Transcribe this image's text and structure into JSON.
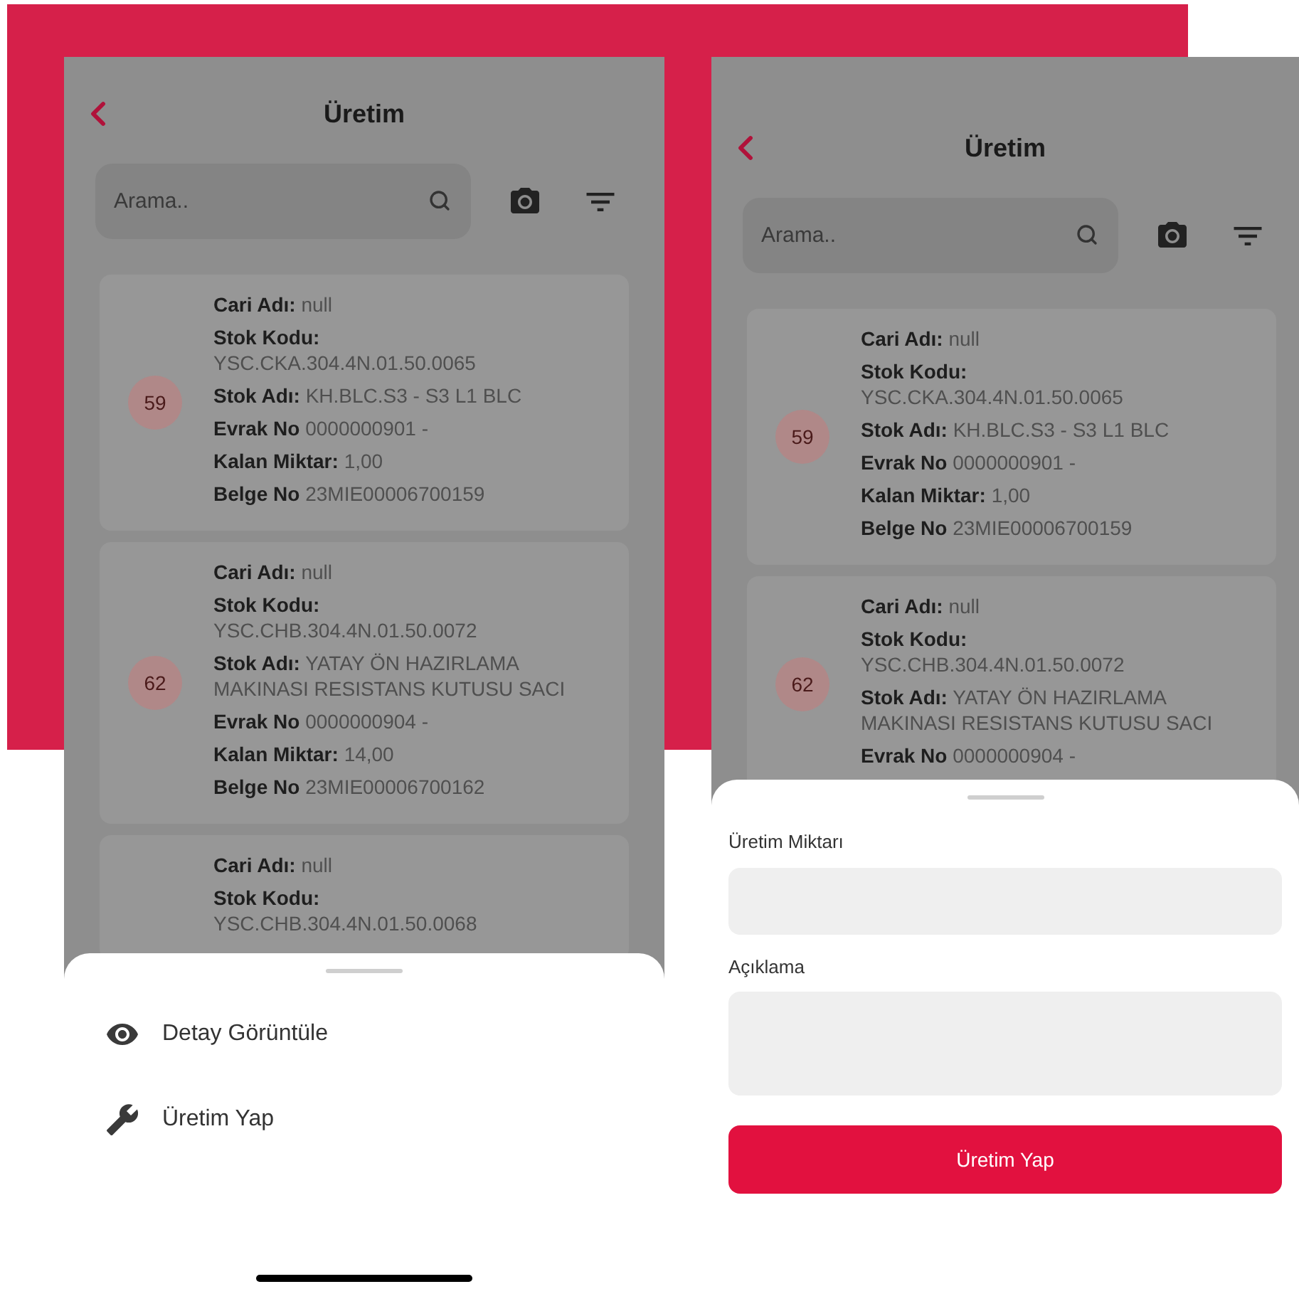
{
  "screens": [
    {
      "title": "Üretim",
      "search": {
        "placeholder": "Arama.."
      },
      "records": [
        {
          "number": "59",
          "fields": [
            {
              "label": "Cari Adı:",
              "value": "null",
              "kind": "inline"
            },
            {
              "label": "Stok Kodu:",
              "value": "YSC.CKA.304.4N.01.50.0065",
              "kind": "stacked"
            },
            {
              "label": "Stok Adı:",
              "value": "KH.BLC.S3 - S3 L1 BLC",
              "kind": "inline"
            },
            {
              "label": "Evrak No",
              "value": "0000000901 -",
              "kind": "inline"
            },
            {
              "label": "Kalan Miktar:",
              "value": "1,00",
              "kind": "inline"
            },
            {
              "label": "Belge No",
              "value": "23MIE00006700159",
              "kind": "inline"
            }
          ]
        },
        {
          "number": "62",
          "fields": [
            {
              "label": "Cari Adı:",
              "value": "null",
              "kind": "inline"
            },
            {
              "label": "Stok Kodu:",
              "value": "YSC.CHB.304.4N.01.50.0072",
              "kind": "stacked"
            },
            {
              "label": "Stok Adı:",
              "value": "YATAY ÖN HAZIRLAMA MAKINASI RESISTANS KUTUSU  SACI",
              "kind": "inline"
            },
            {
              "label": "Evrak No",
              "value": "0000000904 -",
              "kind": "inline"
            },
            {
              "label": "Kalan Miktar:",
              "value": "14,00",
              "kind": "inline"
            },
            {
              "label": "Belge No",
              "value": "23MIE00006700162",
              "kind": "inline"
            }
          ]
        },
        {
          "fields": [
            {
              "label": "Cari Adı:",
              "value": "null",
              "kind": "inline"
            },
            {
              "label": "Stok Kodu:",
              "value": "YSC.CHB.304.4N.01.50.0068",
              "kind": "stacked"
            }
          ]
        }
      ],
      "sheet": {
        "kind": "menu",
        "items": [
          {
            "label": "Detay Görüntüle",
            "kind": "view"
          },
          {
            "label": "Üretim Yap",
            "kind": "produce"
          }
        ]
      }
    },
    {
      "title": "Üretim",
      "search": {
        "placeholder": "Arama.."
      },
      "records": [
        {
          "number": "59",
          "fields": [
            {
              "label": "Cari Adı:",
              "value": "null",
              "kind": "inline"
            },
            {
              "label": "Stok Kodu:",
              "value": "YSC.CKA.304.4N.01.50.0065",
              "kind": "stacked"
            },
            {
              "label": "Stok Adı:",
              "value": "KH.BLC.S3 - S3 L1 BLC",
              "kind": "inline"
            },
            {
              "label": "Evrak No",
              "value": "0000000901 -",
              "kind": "inline"
            },
            {
              "label": "Kalan Miktar:",
              "value": "1,00",
              "kind": "inline"
            },
            {
              "label": "Belge No",
              "value": "23MIE00006700159",
              "kind": "inline"
            }
          ]
        },
        {
          "number": "62",
          "fields": [
            {
              "label": "Cari Adı:",
              "value": "null",
              "kind": "inline"
            },
            {
              "label": "Stok Kodu:",
              "value": "YSC.CHB.304.4N.01.50.0072",
              "kind": "stacked"
            },
            {
              "label": "Stok Adı:",
              "value": "YATAY ÖN HAZIRLAMA MAKINASI RESISTANS KUTUSU  SACI",
              "kind": "inline"
            },
            {
              "label": "Evrak No",
              "value": "0000000904 -",
              "kind": "inline"
            }
          ]
        }
      ],
      "sheet": {
        "kind": "form",
        "fields": [
          {
            "label": "Üretim Miktarı",
            "kind": "input"
          },
          {
            "label": "Açıklama",
            "kind": "textarea"
          }
        ],
        "button": "Üretim Yap"
      }
    }
  ]
}
